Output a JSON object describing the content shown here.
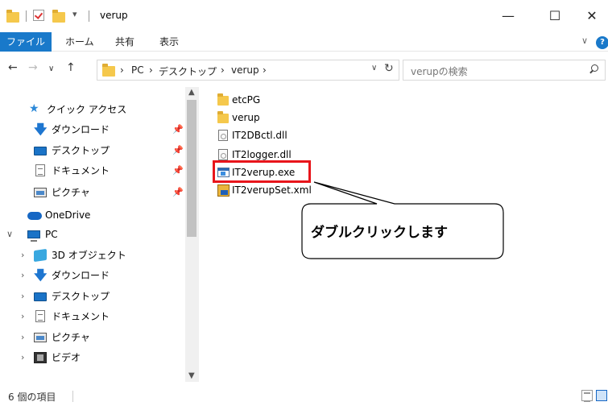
{
  "titlebar": {
    "title": "verup",
    "minimize": "—",
    "maximize": "☐",
    "close": "✕"
  },
  "ribbon": {
    "tabs": [
      "ファイル",
      "ホーム",
      "共有",
      "表示"
    ],
    "collapse": "∨",
    "help": "?"
  },
  "address_bar": {
    "back": "←",
    "forward": "→",
    "recent": "∨",
    "up": "↑",
    "crumbs": [
      "PC",
      "デスクトップ",
      "verup"
    ],
    "dropdown": "∨",
    "refresh": "↻"
  },
  "search": {
    "placeholder": "verupの検索"
  },
  "nav": {
    "quick_access": "クイック アクセス",
    "items": [
      {
        "label": "ダウンロード",
        "icon": "download-icon",
        "pinned": true
      },
      {
        "label": "デスクトップ",
        "icon": "desktop-icon",
        "pinned": true
      },
      {
        "label": "ドキュメント",
        "icon": "document-icon",
        "pinned": true
      },
      {
        "label": "ピクチャ",
        "icon": "pictures-icon",
        "pinned": true
      }
    ],
    "onedrive": "OneDrive",
    "pc": "PC",
    "pc_items": [
      {
        "label": "3D オブジェクト",
        "icon": "3d-objects-icon"
      },
      {
        "label": "ダウンロード",
        "icon": "download-icon"
      },
      {
        "label": "デスクトップ",
        "icon": "desktop-icon"
      },
      {
        "label": "ドキュメント",
        "icon": "document-icon"
      },
      {
        "label": "ピクチャ",
        "icon": "pictures-icon"
      },
      {
        "label": "ビデオ",
        "icon": "video-icon"
      }
    ],
    "pin_glyph": "📌",
    "collapse_glyph": "∨",
    "expand_glyph": "›"
  },
  "files": [
    {
      "name": "etcPG",
      "type": "folder"
    },
    {
      "name": "verup",
      "type": "folder"
    },
    {
      "name": "IT2DBctl.dll",
      "type": "dll"
    },
    {
      "name": "IT2logger.dll",
      "type": "dll"
    },
    {
      "name": "IT2verup.exe",
      "type": "exe"
    },
    {
      "name": "IT2verupSet.xml",
      "type": "xml"
    }
  ],
  "callout": {
    "text": "ダブルクリックします"
  },
  "status": {
    "item_count": "6 個の項目"
  },
  "colors": {
    "accent": "#1979ca",
    "highlight": "#e8151b"
  }
}
